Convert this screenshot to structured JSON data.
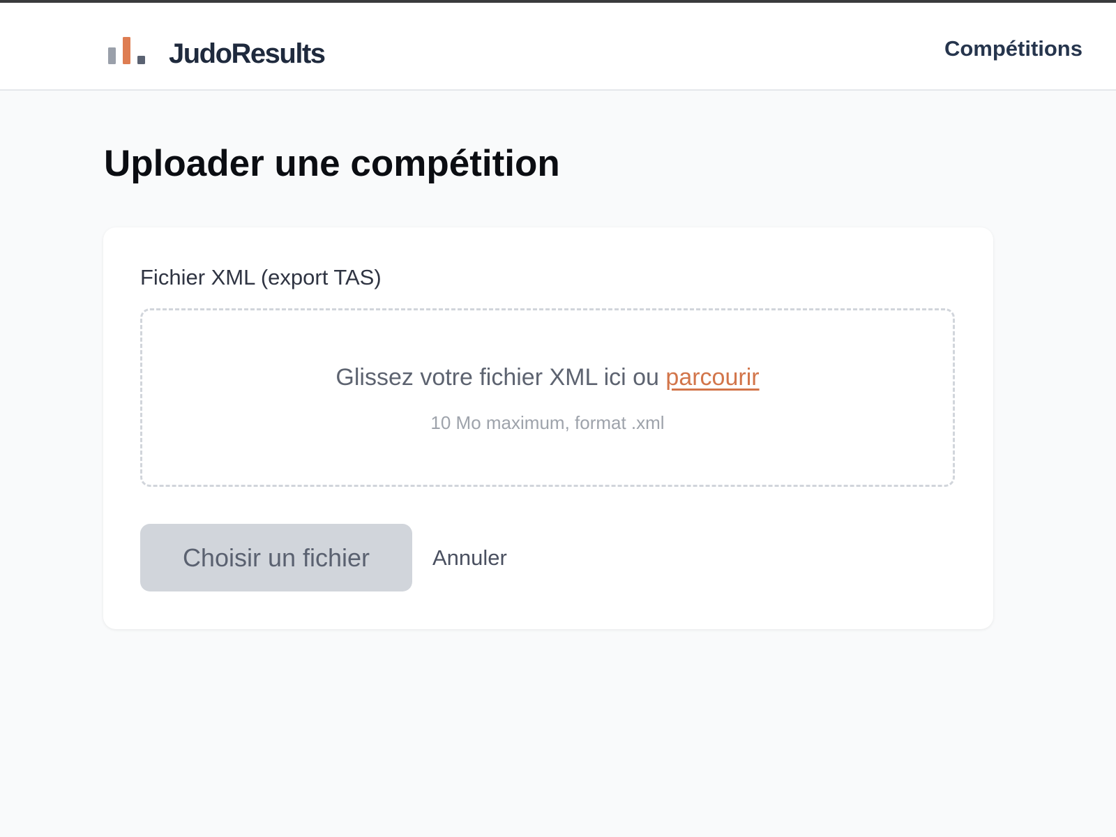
{
  "header": {
    "brand": "JudoResults",
    "logo_icon": "bar-chart-logo-icon",
    "nav": {
      "competitions_label": "Compétitions"
    }
  },
  "page": {
    "title": "Uploader une compétition"
  },
  "form": {
    "file_label": "Fichier XML (export TAS)",
    "dropzone": {
      "prompt": "Glissez votre fichier XML ici ou ",
      "browse_label": "parcourir",
      "hint": "10 Mo maximum, format .xml"
    },
    "choose_button_label": "Choisir un fichier",
    "cancel_label": "Annuler"
  },
  "colors": {
    "accent": "#d2754a",
    "brand_text": "#1f2a3d",
    "button_disabled_bg": "#d1d5db",
    "page_background": "#f9fafb"
  }
}
